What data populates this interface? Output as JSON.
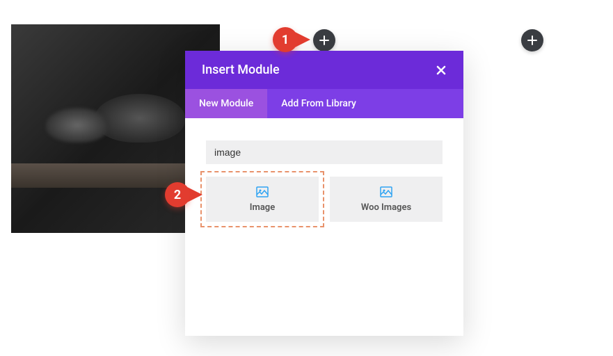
{
  "modal": {
    "title": "Insert Module",
    "tabs": {
      "new": "New Module",
      "library": "Add From Library"
    },
    "search_value": "image",
    "modules": {
      "image": "Image",
      "woo": "Woo Images"
    }
  },
  "annotations": {
    "step1": "1",
    "step2": "2"
  }
}
